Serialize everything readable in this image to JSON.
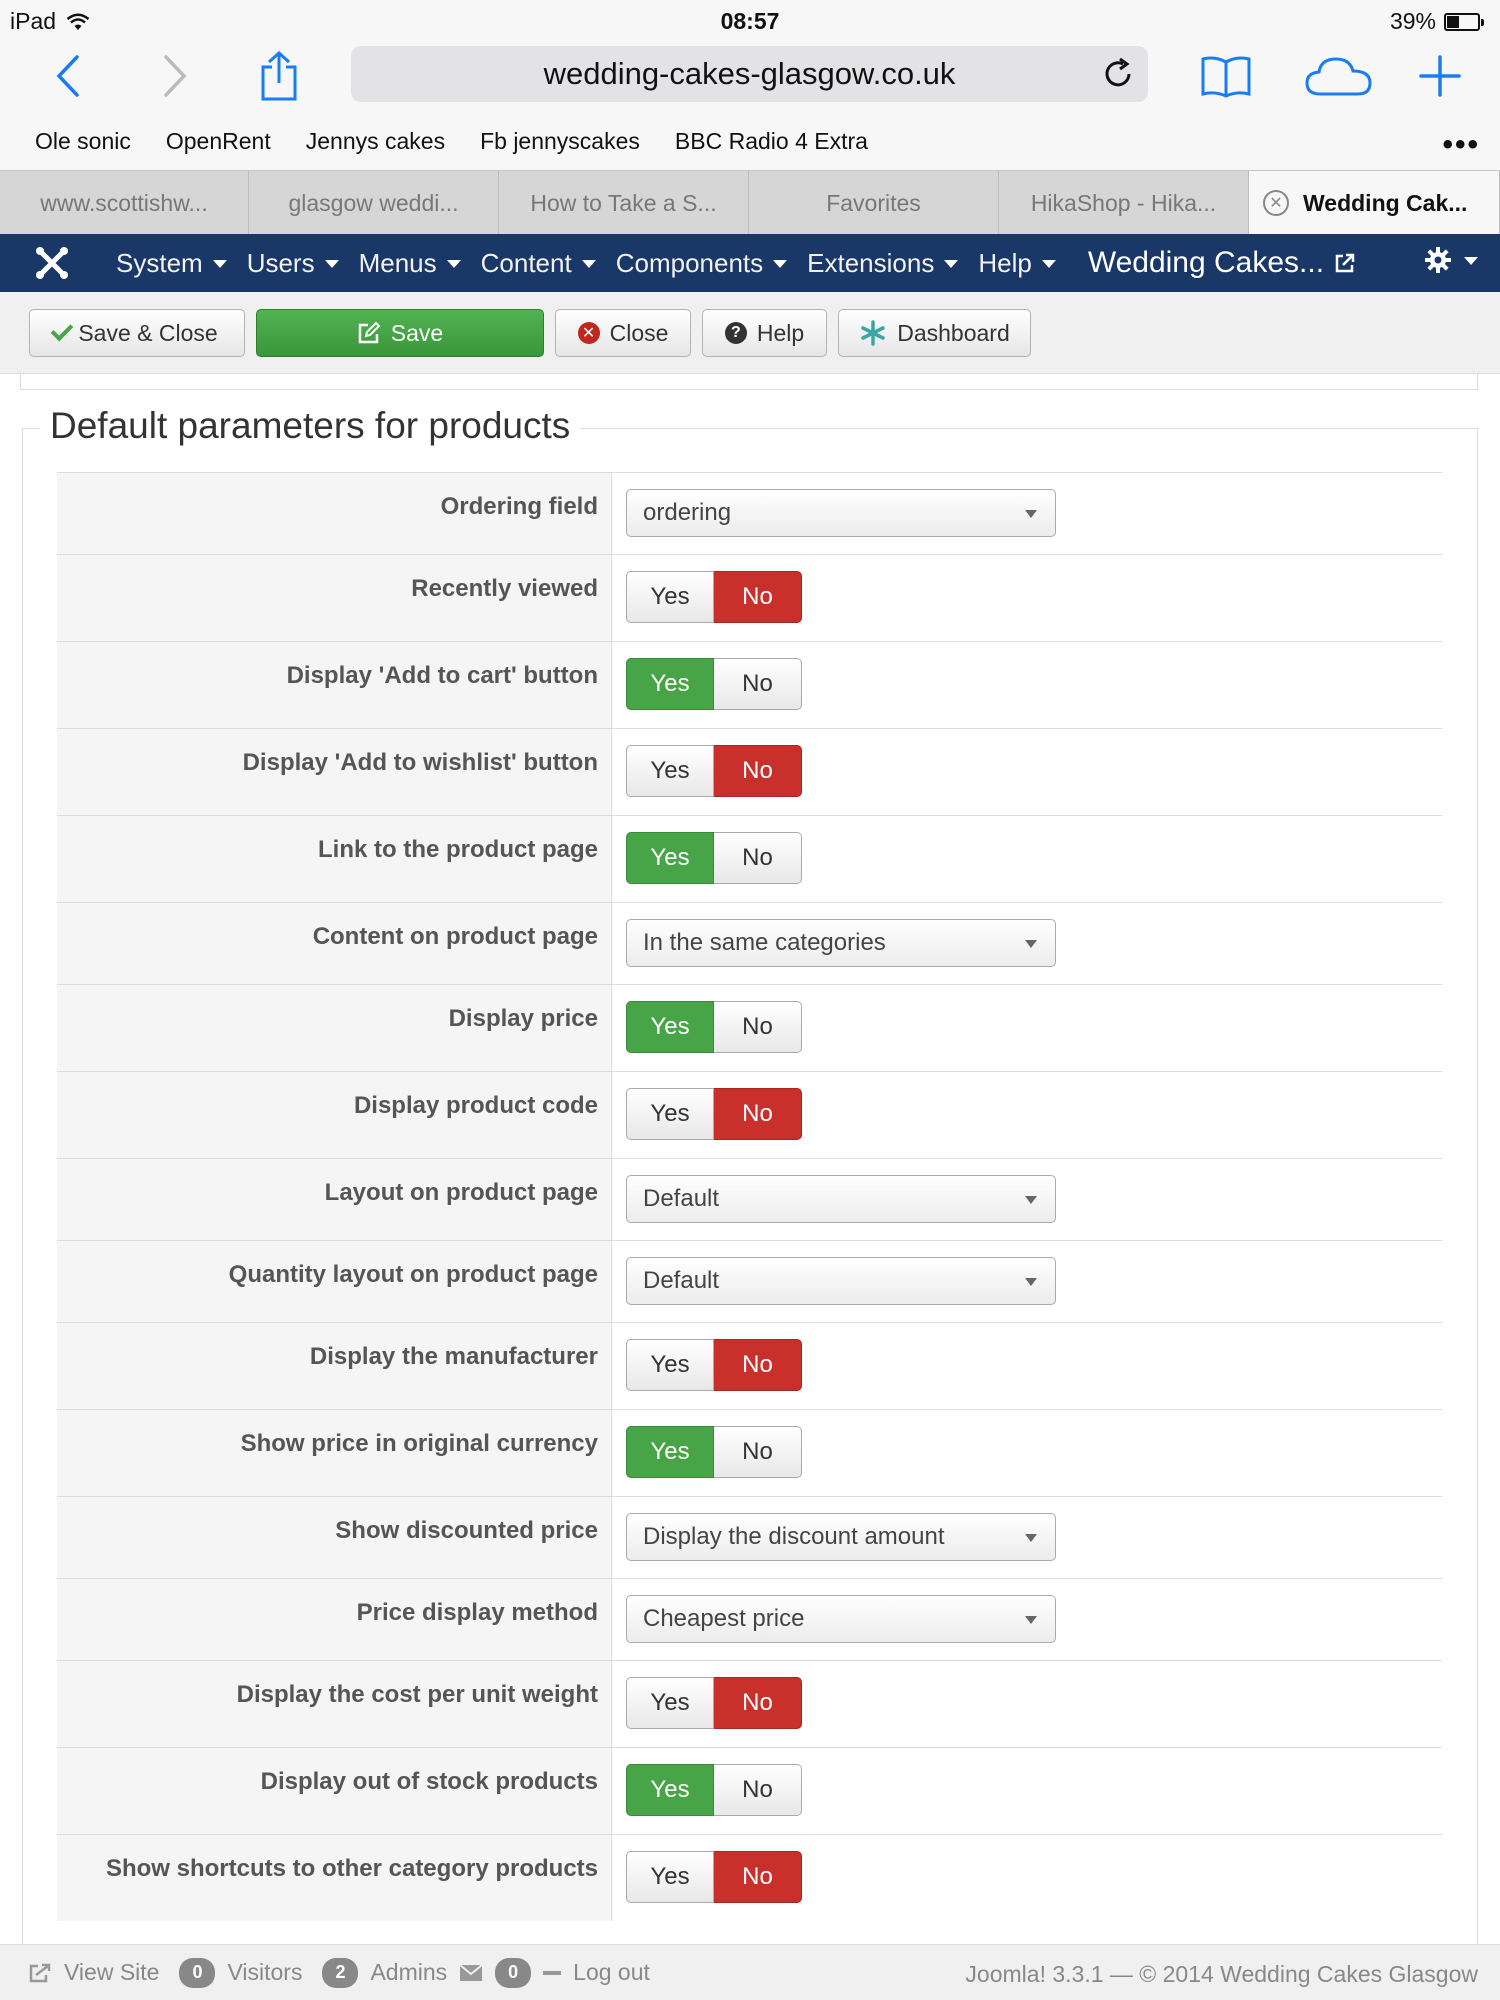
{
  "status_bar": {
    "device": "iPad",
    "time": "08:57",
    "battery": "39%",
    "battery_level": 0.39
  },
  "browser": {
    "url": "wedding-cakes-glasgow.co.uk",
    "bookmarks": [
      "Ole sonic",
      "OpenRent",
      "Jennys cakes",
      "Fb jennyscakes",
      "BBC Radio 4 Extra"
    ],
    "tabs": [
      "www.scottishw...",
      "glasgow weddi...",
      "How to Take a S...",
      "Favorites",
      "HikaShop - Hika...",
      "Wedding Cak..."
    ]
  },
  "admin_menu": {
    "items": [
      "System",
      "Users",
      "Menus",
      "Content",
      "Components",
      "Extensions",
      "Help"
    ],
    "site_name": "Wedding Cakes..."
  },
  "toolbar": {
    "save_close": "Save & Close",
    "save": "Save",
    "close": "Close",
    "help": "Help",
    "dashboard": "Dashboard"
  },
  "form": {
    "legend": "Default parameters for products",
    "yes_label": "Yes",
    "no_label": "No",
    "rows": [
      {
        "label": "Ordering field",
        "type": "select",
        "value": "ordering"
      },
      {
        "label": "Recently viewed",
        "type": "toggle",
        "value": "No"
      },
      {
        "label": "Display 'Add to cart' button",
        "type": "toggle",
        "value": "Yes"
      },
      {
        "label": "Display 'Add to wishlist' button",
        "type": "toggle",
        "value": "No"
      },
      {
        "label": "Link to the product page",
        "type": "toggle",
        "value": "Yes"
      },
      {
        "label": "Content on product page",
        "type": "select",
        "value": "In the same categories"
      },
      {
        "label": "Display price",
        "type": "toggle",
        "value": "Yes"
      },
      {
        "label": "Display product code",
        "type": "toggle",
        "value": "No"
      },
      {
        "label": "Layout on product page",
        "type": "select",
        "value": "Default"
      },
      {
        "label": "Quantity layout on product page",
        "type": "select",
        "value": "Default"
      },
      {
        "label": "Display the manufacturer",
        "type": "toggle",
        "value": "No"
      },
      {
        "label": "Show price in original currency",
        "type": "toggle",
        "value": "Yes"
      },
      {
        "label": "Show discounted price",
        "type": "select",
        "value": "Display the discount amount"
      },
      {
        "label": "Price display method",
        "type": "select",
        "value": "Cheapest price"
      },
      {
        "label": "Display the cost per unit weight",
        "type": "toggle",
        "value": "No"
      },
      {
        "label": "Display out of stock products",
        "type": "toggle",
        "value": "Yes"
      },
      {
        "label": "Show shortcuts to other category products",
        "type": "toggle",
        "value": "No"
      }
    ]
  },
  "footer": {
    "view_site": "View Site",
    "visitors_count": "0",
    "visitors_label": "Visitors",
    "admins_count": "2",
    "admins_label": "Admins",
    "messages_count": "0",
    "logout": "Log out",
    "version": "Joomla! 3.3.1  —  © 2014 Wedding Cakes Glasgow"
  },
  "colors": {
    "navbar": "#1a3867",
    "yes_active": "#47a447",
    "no_active": "#c9302c",
    "save_button": "#46a546"
  }
}
